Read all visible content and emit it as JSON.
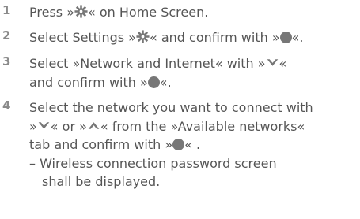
{
  "steps": [
    {
      "number": "1",
      "lines": [
        {
          "a": "Press »",
          "b": "« on Home Screen."
        }
      ]
    },
    {
      "number": "2",
      "lines": [
        {
          "a": "Select Settings »",
          "b": "«  and confirm with »",
          "c": "«."
        }
      ]
    },
    {
      "number": "3",
      "lines": [
        {
          "a": "Select »Network and Internet« with »",
          "b": "«"
        },
        {
          "a": "and confirm with »",
          "b": "«."
        }
      ]
    },
    {
      "number": "4",
      "lines": [
        {
          "a": "Select the network you want to connect with"
        },
        {
          "a": "»",
          "b": "« or »",
          "c": "« from the »Available networks«"
        },
        {
          "a": "tab and confirm with »",
          "b": "« ."
        },
        {
          "a": "– Wireless connection password screen"
        },
        {
          "a": "shall be displayed."
        }
      ]
    }
  ],
  "icons": {
    "settings": "gear-icon",
    "ok": "ok-button-icon",
    "down": "down-arrow-icon",
    "up": "up-arrow-icon"
  },
  "colors": {
    "text": "#555555",
    "number": "#8a8a8a",
    "icon": "#777777"
  }
}
